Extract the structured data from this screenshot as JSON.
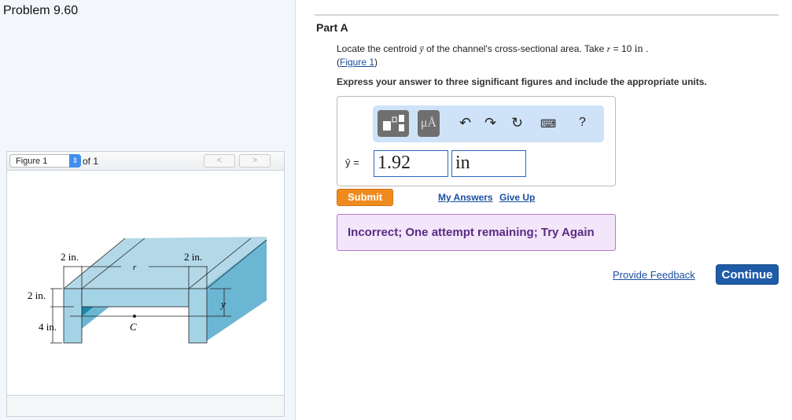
{
  "problem_title": "Problem 9.60",
  "figure": {
    "select_value": "Figure 1",
    "of_label": "of 1",
    "prev": "<",
    "next": ">",
    "labels": {
      "top_left": "2 in.",
      "top_right": "2 in.",
      "r": "r",
      "left_top": "2 in.",
      "left_bottom": "4 in.",
      "ybar": "y",
      "centroid": "C"
    }
  },
  "part": {
    "title": "Part A",
    "q_pre": "Locate the centroid ",
    "q_sym": "ȳ",
    "q_mid": " of the channel's cross-sectional area. Take ",
    "q_r": "r",
    "q_eq": " = 10 ",
    "q_unit": "in",
    "q_end": " .",
    "fig_open": "(",
    "fig_link": "Figure 1",
    "fig_close": ")",
    "instruction": "Express your answer to three significant figures and include the appropriate units.",
    "toolbar": {
      "units": "μÅ",
      "help": "?"
    },
    "answer_label": "ȳ =",
    "answer_value": "1.92",
    "answer_unit": "in",
    "submit": "Submit",
    "my_answers": "My Answers",
    "give_up": "Give Up",
    "feedback": "Incorrect; One attempt remaining; Try Again"
  },
  "provide_feedback": "Provide Feedback",
  "continue": "Continue"
}
